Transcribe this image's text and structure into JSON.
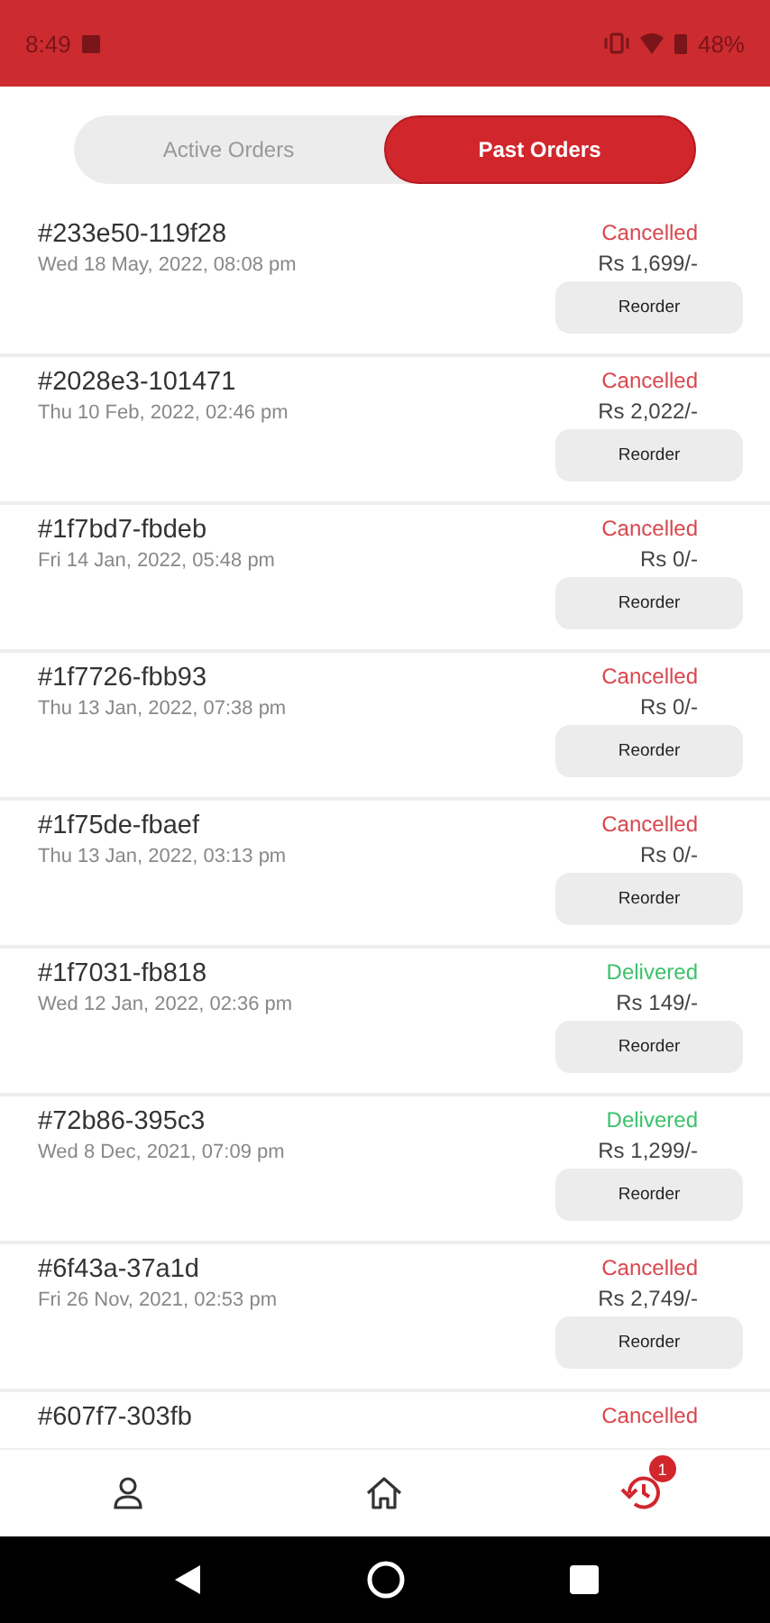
{
  "status_bar": {
    "time": "8:49",
    "battery": "48%"
  },
  "tabs": [
    {
      "label": "Active Orders",
      "selected": false
    },
    {
      "label": "Past Orders",
      "selected": true
    }
  ],
  "orders": [
    {
      "id": "#233e50-119f28",
      "date": "Wed 18 May, 2022, 08:08 pm",
      "status": "Cancelled",
      "color": "#d9464e",
      "amount": "Rs 1,699/-",
      "button": "Reorder"
    },
    {
      "id": "#2028e3-101471",
      "date": "Thu 10 Feb, 2022, 02:46 pm",
      "status": "Cancelled",
      "color": "#d9464e",
      "amount": "Rs 2,022/-",
      "button": "Reorder"
    },
    {
      "id": "#1f7bd7-fbdeb",
      "date": "Fri 14 Jan, 2022, 05:48 pm",
      "status": "Cancelled",
      "color": "#d9464e",
      "amount": "Rs 0/-",
      "button": "Reorder"
    },
    {
      "id": "#1f7726-fbb93",
      "date": "Thu 13 Jan, 2022, 07:38 pm",
      "status": "Cancelled",
      "color": "#d9464e",
      "amount": "Rs 0/-",
      "button": "Reorder"
    },
    {
      "id": "#1f75de-fbaef",
      "date": "Thu 13 Jan, 2022, 03:13 pm",
      "status": "Cancelled",
      "color": "#d9464e",
      "amount": "Rs 0/-",
      "button": "Reorder"
    },
    {
      "id": "#1f7031-fb818",
      "date": "Wed 12 Jan, 2022, 02:36 pm",
      "status": "Delivered",
      "color": "#3cc26a",
      "amount": "Rs 149/-",
      "button": "Reorder"
    },
    {
      "id": "#72b86-395c3",
      "date": "Wed 8 Dec, 2021, 07:09 pm",
      "status": "Delivered",
      "color": "#3cc26a",
      "amount": "Rs 1,299/-",
      "button": "Reorder"
    },
    {
      "id": "#6f43a-37a1d",
      "date": "Fri 26 Nov, 2021, 02:53 pm",
      "status": "Cancelled",
      "color": "#d9464e",
      "amount": "Rs 2,749/-",
      "button": "Reorder"
    },
    {
      "id": "#607f7-303fb",
      "status": "Cancelled",
      "color": "#d9464e"
    }
  ],
  "bottom_nav": [
    {
      "kind": "profile",
      "selected": false
    },
    {
      "kind": "home",
      "selected": false
    },
    {
      "kind": "history",
      "selected": true,
      "badge": "1"
    }
  ]
}
